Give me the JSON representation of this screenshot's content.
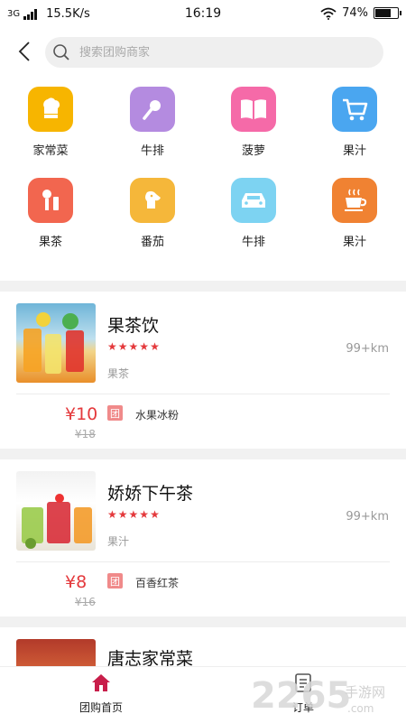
{
  "status_bar": {
    "network": "3G",
    "speed": "15.5K/s",
    "time": "16:19",
    "battery": "74%",
    "battery_level": 0.74
  },
  "header": {
    "search_placeholder": "搜索团购商家"
  },
  "categories": [
    {
      "label": "家常菜",
      "icon": "chef-hat-icon",
      "color": "#f7b500"
    },
    {
      "label": "牛排",
      "icon": "microphone-icon",
      "color": "#b48be0"
    },
    {
      "label": "菠萝",
      "icon": "book-icon",
      "color": "#f56aa8"
    },
    {
      "label": "果汁",
      "icon": "shopping-cart-icon",
      "color": "#4aa6f0"
    },
    {
      "label": "果茶",
      "icon": "makeup-icon",
      "color": "#f2664f"
    },
    {
      "label": "番茄",
      "icon": "dog-icon",
      "color": "#f5b73a"
    },
    {
      "label": "牛排",
      "icon": "car-icon",
      "color": "#7dd3f2"
    },
    {
      "label": "果汁",
      "icon": "coffee-cup-icon",
      "color": "#f08232"
    }
  ],
  "shops": [
    {
      "name": "果茶饮",
      "rating": 5,
      "distance": "99+km",
      "category": "果茶",
      "price": "¥10",
      "original_price": "¥18",
      "deal_badge": "团",
      "deal": "水果冰粉"
    },
    {
      "name": "娇娇下午茶",
      "rating": 5,
      "distance": "99+km",
      "category": "果汁",
      "price": "¥8",
      "original_price": "¥16",
      "deal_badge": "团",
      "deal": "百香红茶"
    },
    {
      "name": "唐志家常菜"
    }
  ],
  "tabbar": {
    "tabs": [
      {
        "label": "团购首页",
        "icon": "home-icon",
        "active": true
      },
      {
        "label": "订单",
        "icon": "order-list-icon",
        "active": false
      }
    ]
  },
  "watermark": {
    "number": "2265",
    "suffix": ".com",
    "brand": "手游网"
  },
  "colors": {
    "accent": "#e4393c",
    "divider": "#f1f1f1",
    "active_tab": "#c81e4a"
  }
}
